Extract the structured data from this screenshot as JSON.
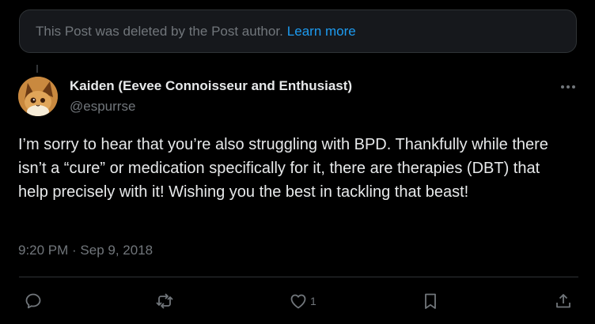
{
  "deleted_notice": {
    "text": "This Post was deleted by the Post author.",
    "link": "Learn more"
  },
  "tweet": {
    "author_name": "Kaiden (Eevee Connoisseur and Enthusiast)",
    "author_handle": "@espurrse",
    "text": "I’m sorry to hear that you’re also struggling with BPD. Thankfully while there isn’t a “cure” or medication specifically for it, there are therapies (DBT) that help precisely with it! Wishing you the best in tackling that beast!",
    "timestamp": "9:20 PM · Sep 9, 2018"
  },
  "actions": {
    "reply_icon": "reply-icon",
    "repost_icon": "repost-icon",
    "like_icon": "heart-icon",
    "like_count": "1",
    "bookmark_icon": "bookmark-icon",
    "share_icon": "share-icon"
  },
  "colors": {
    "background": "#000000",
    "text_primary": "#e7e9ea",
    "text_secondary": "#71767b",
    "link": "#1d9bf0",
    "border": "#2f3336",
    "card_background": "#16181c"
  }
}
